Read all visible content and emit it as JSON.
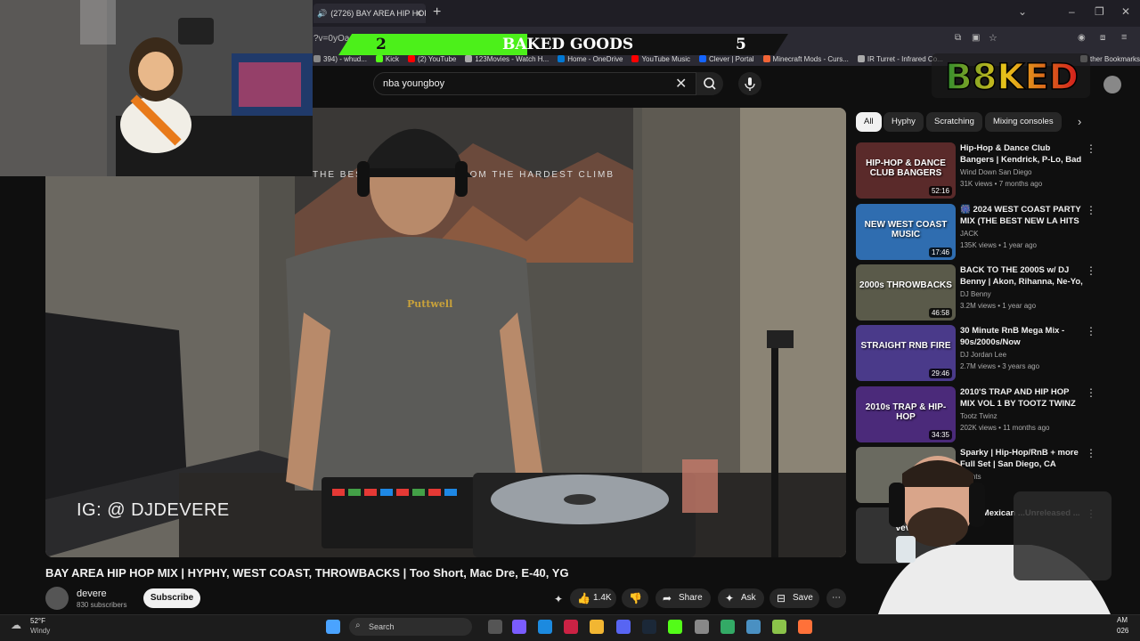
{
  "browser": {
    "tab_title": "(2726) BAY AREA HIP HOP",
    "url_fragment": "?v=0yOaa",
    "bookmarks": [
      {
        "label": "394) - whud...",
        "color": "#888"
      },
      {
        "label": "Kick",
        "color": "#53fc18"
      },
      {
        "label": "(2) YouTube",
        "color": "#ff0000"
      },
      {
        "label": "123Movies - Watch H...",
        "color": "#aaa"
      },
      {
        "label": "Home - OneDrive",
        "color": "#0078d4"
      },
      {
        "label": "YouTube Music",
        "color": "#ff0000"
      },
      {
        "label": "Clever | Portal",
        "color": "#1464ff"
      },
      {
        "label": "Minecraft Mods - Curs...",
        "color": "#f16436"
      },
      {
        "label": "IR Turret - Infrared Co...",
        "color": "#aaa"
      },
      {
        "label": "ther Bookmarks",
        "color": "#aaa"
      }
    ]
  },
  "overlay": {
    "score_left": "2",
    "title": "BAKED GOODS",
    "score_right": "5",
    "logo_text": "B8KED"
  },
  "search": {
    "value": "nba youngboy"
  },
  "video": {
    "watermark": "IG: @ DJDEVERE",
    "poster_text": "THE BEST VIEWS COME FROM THE HARDEST CLIMB",
    "shirt_text": "Puttwell",
    "title": "BAY AREA HIP HOP MIX | HYPHY, WEST COAST, THROWBACKS | Too Short, Mac Dre, E-40, YG",
    "channel": "devere",
    "subscribers": "830 subscribers",
    "subscribe_label": "Subscribe",
    "likes": "1.4K",
    "share_label": "Share",
    "ask_label": "Ask",
    "save_label": "Save"
  },
  "chips": [
    "All",
    "Hyphy",
    "Scratching",
    "Mixing consoles"
  ],
  "recommendations": [
    {
      "title": "Hip-Hop & Dance Club Bangers | Kendrick, P-Lo, Bad Bunny | ...",
      "channel": "Wind Down San Diego",
      "meta": "31K views • 7 months ago",
      "duration": "52:16",
      "thumb_text": "HIP-HOP & DANCE CLUB BANGERS",
      "thumb_color": "#5a2a2a"
    },
    {
      "title": "🎆 2024 WEST COAST PARTY MIX (THE BEST NEW LA HITS ...",
      "channel": "JACK",
      "meta": "135K views • 1 year ago",
      "duration": "17:46",
      "thumb_text": "NEW WEST COAST MUSIC",
      "thumb_color": "#2f6db0"
    },
    {
      "title": "BACK TO THE 2000S w/ DJ Benny | Akon, Rihanna, Ne-Yo, ...",
      "channel": "DJ Benny",
      "meta": "3.2M views • 1 year ago",
      "duration": "46:58",
      "thumb_text": "2000s THROWBACKS",
      "thumb_color": "#5a5a4a"
    },
    {
      "title": "30 Minute RnB Mega Mix - 90s/2000s/Now",
      "channel": "DJ Jordan Lee",
      "meta": "2.7M views • 3 years ago",
      "duration": "29:46",
      "thumb_text": "STRAIGHT RNB FIRE",
      "thumb_color": "#4a3a8a"
    },
    {
      "title": "2010'S TRAP AND HIP HOP MIX VOL 1 BY TOOTZ TWINZ ...",
      "channel": "Tootz Twinz",
      "meta": "202K views • 11 months ago",
      "duration": "34:35",
      "thumb_text": "2010s TRAP & HIP-HOP",
      "thumb_color": "#4b2a7a"
    },
    {
      "title": "Sparky | Hip-Hop/RnB + more Full Set | San Diego, CA",
      "channel": "...aints",
      "meta": "...ago",
      "duration": "",
      "thumb_text": "",
      "thumb_color": "#6a6a60"
    },
    {
      "title": "...hat Mexican ...Unreleased ...",
      "channel": "",
      "meta": "",
      "duration": "",
      "thumb_text": "vevo",
      "thumb_color": "#333"
    }
  ],
  "taskbar": {
    "temp": "52°F",
    "weather": "Windy",
    "search_label": "Search",
    "time": "AM",
    "date": "026"
  }
}
